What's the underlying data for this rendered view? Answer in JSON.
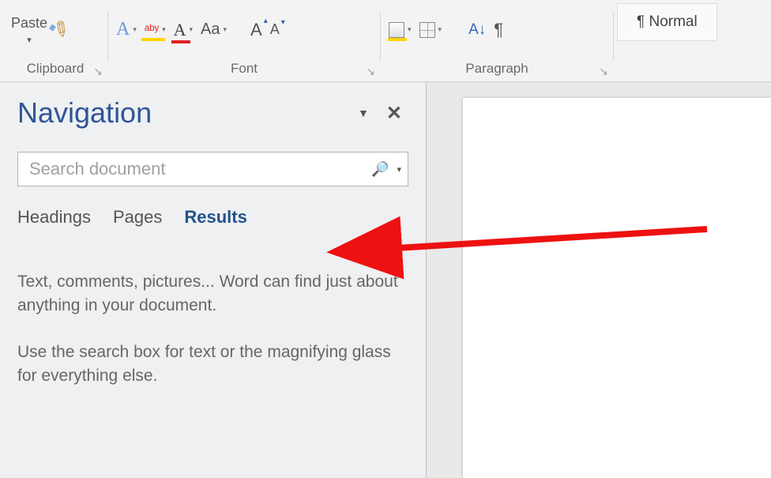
{
  "ribbon": {
    "groups": {
      "clipboard": {
        "label": "Clipboard",
        "paste": "Paste"
      },
      "font": {
        "label": "Font"
      },
      "paragraph": {
        "label": "Paragraph"
      },
      "styles": {
        "item1": "¶ Normal"
      }
    },
    "font_controls": {
      "text_effects": "A",
      "highlight": "ᵃᵇʸ",
      "font_color": "A",
      "change_case": "Aa",
      "grow": "A",
      "grow_mark": "▴",
      "shrink": "A",
      "shrink_mark": "▾"
    },
    "paragraph_controls": {
      "sort": "A↓",
      "pilcrow": "¶"
    }
  },
  "navigation": {
    "title": "Navigation",
    "search_placeholder": "Search document",
    "tabs": {
      "headings": "Headings",
      "pages": "Pages",
      "results": "Results"
    },
    "help1": "Text, comments, pictures... Word can find just about anything in your document.",
    "help2": "Use the search box for text or the magnifying glass for everything else."
  }
}
